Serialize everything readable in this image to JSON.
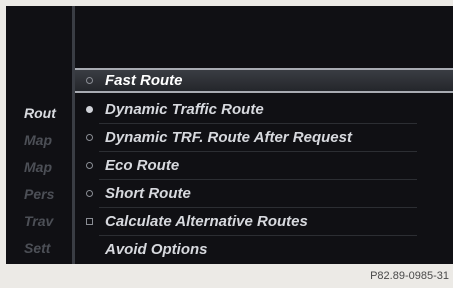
{
  "sidebar": {
    "items": [
      {
        "label": "Rout",
        "active": true
      },
      {
        "label": "Map",
        "active": false
      },
      {
        "label": "Map",
        "active": false
      },
      {
        "label": "Pers",
        "active": false
      },
      {
        "label": "Trav",
        "active": false
      },
      {
        "label": "Sett",
        "active": false
      }
    ]
  },
  "route_options": [
    {
      "label": "Fast Route",
      "control": "radio",
      "checked": false,
      "selected": true
    },
    {
      "label": "Dynamic Traffic Route",
      "control": "radio",
      "checked": true,
      "selected": false
    },
    {
      "label": "Dynamic TRF. Route After Request",
      "control": "radio",
      "checked": false,
      "selected": false
    },
    {
      "label": "Eco Route",
      "control": "radio",
      "checked": false,
      "selected": false
    },
    {
      "label": "Short Route",
      "control": "radio",
      "checked": false,
      "selected": false
    },
    {
      "label": "Calculate Alternative Routes",
      "control": "checkbox",
      "checked": false,
      "selected": false
    },
    {
      "label": "Avoid Options",
      "control": "none",
      "checked": false,
      "selected": false
    }
  ],
  "caption": "P82.89-0985-31"
}
